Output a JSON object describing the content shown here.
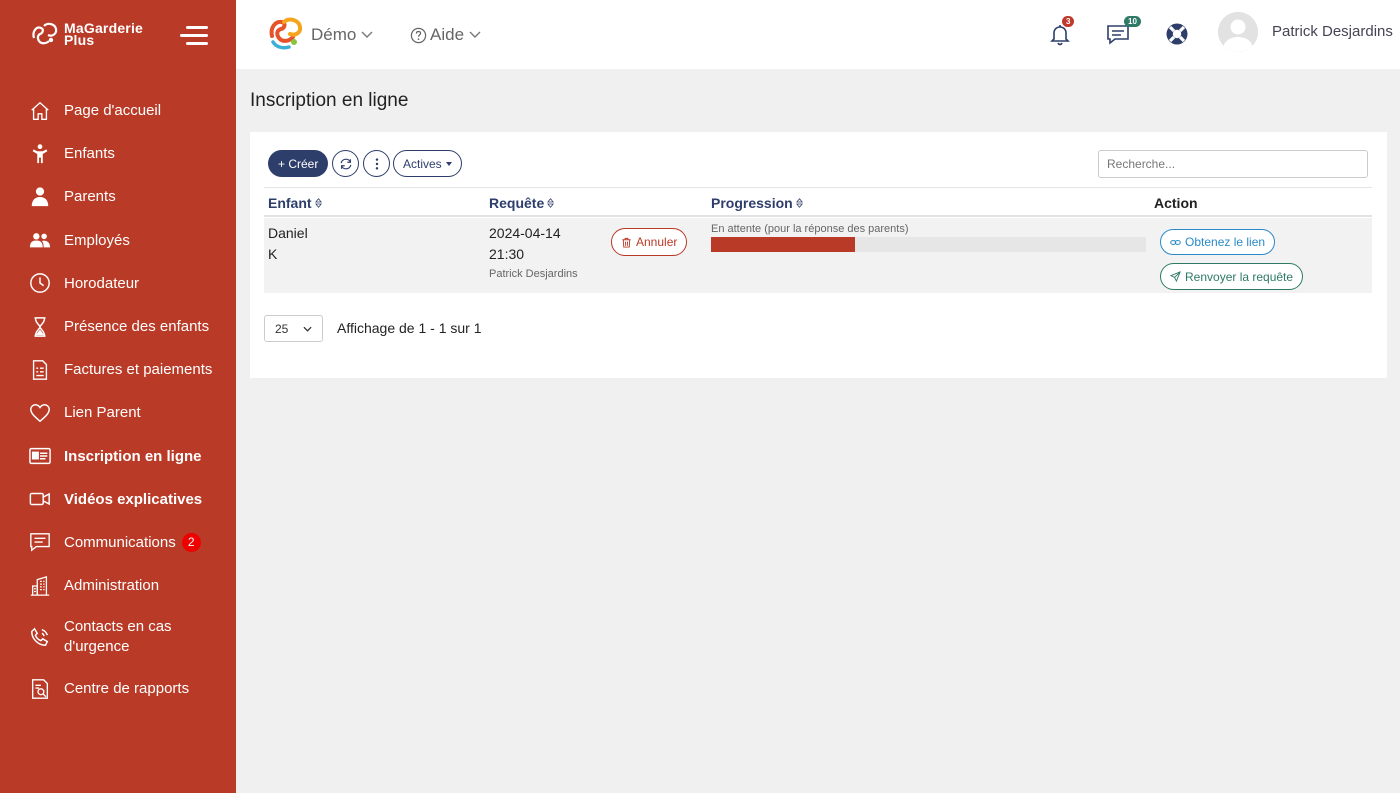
{
  "app": {
    "logo_line1": "MaGarderie",
    "logo_line2": "Plus",
    "accent_color": "#b93a26",
    "primary_color": "#2e3e6b"
  },
  "sidebar": {
    "items": [
      {
        "label": "Page d'accueil",
        "icon": "home-icon"
      },
      {
        "label": "Enfants",
        "icon": "child-icon"
      },
      {
        "label": "Parents",
        "icon": "parent-icon"
      },
      {
        "label": "Employés",
        "icon": "employees-icon"
      },
      {
        "label": "Horodateur",
        "icon": "clock-icon"
      },
      {
        "label": "Présence des enfants",
        "icon": "hourglass-icon"
      },
      {
        "label": "Factures et paiements",
        "icon": "invoice-icon"
      },
      {
        "label": "Lien Parent",
        "icon": "heart-icon"
      },
      {
        "label": "Inscription en ligne",
        "icon": "id-card-icon",
        "active": true
      },
      {
        "label": "Vidéos explicatives",
        "icon": "video-icon"
      },
      {
        "label": "Communications",
        "icon": "chat-icon",
        "badge": "2"
      },
      {
        "label": "Administration",
        "icon": "building-icon"
      },
      {
        "label": "Contacts en cas d'urgence",
        "icon": "phone-icon"
      },
      {
        "label": "Centre de rapports",
        "icon": "report-icon"
      }
    ]
  },
  "topbar": {
    "demo_label": "Démo",
    "aide_label": "Aide",
    "notifications_count": "3",
    "messages_count": "10",
    "user_name": "Patrick Desjardins"
  },
  "main": {
    "page_title": "Inscription en ligne",
    "toolbar": {
      "create_label": "+ Créer",
      "filter_label": "Actives",
      "search_placeholder": "Recherche..."
    },
    "table": {
      "columns": [
        "Enfant",
        "Requête",
        "Progression",
        "Action"
      ],
      "rows": [
        {
          "child_first": "Daniel",
          "child_last": "K",
          "request_date": "2024-04-14",
          "request_time": "21:30",
          "requested_by": "Patrick Desjardins",
          "cancel_label": "Annuler",
          "progress_label": "En attente (pour la réponse des parents)",
          "progress_fraction": 0.33,
          "get_link_label": "Obtenez le lien",
          "resend_label": "Renvoyer la requête"
        }
      ]
    },
    "pagination": {
      "page_size": "25",
      "info": "Affichage de 1 - 1 sur 1"
    }
  }
}
